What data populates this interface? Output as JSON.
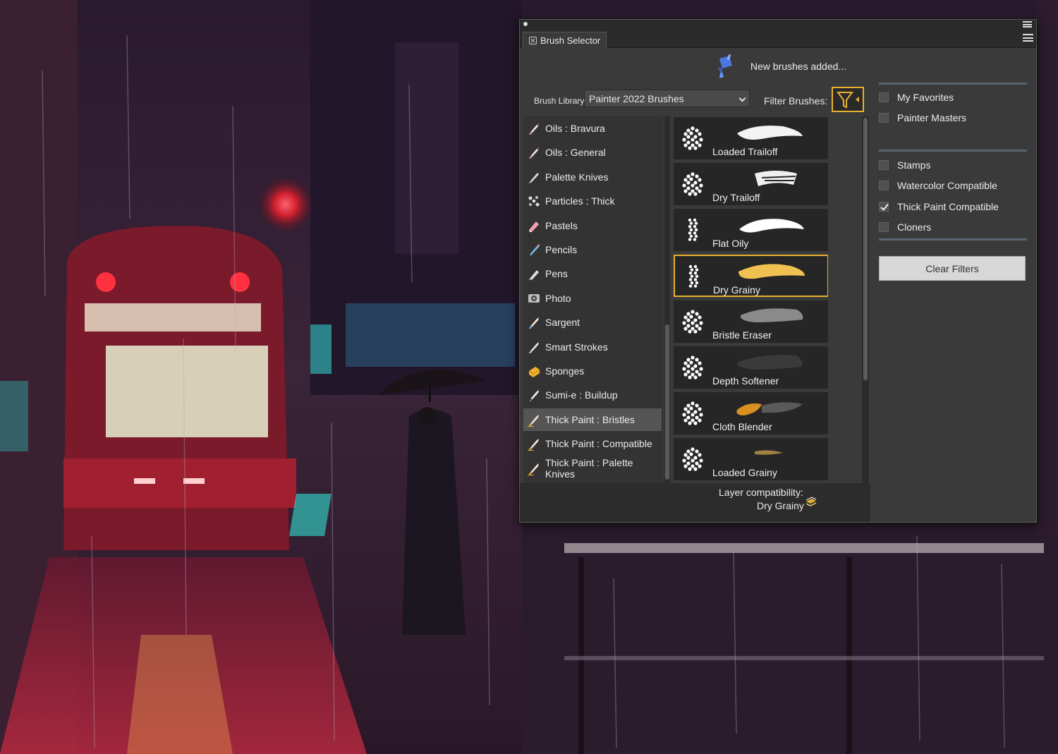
{
  "panel": {
    "tab_title": "Brush Selector",
    "notice": "New brushes added...",
    "library_label": "Brush Library:",
    "library_value": "Painter 2022 Brushes",
    "filter_label": "Filter Brushes:"
  },
  "categories": [
    {
      "label": "Oils : Bravura",
      "icon": "oil-brush-icon"
    },
    {
      "label": "Oils : General",
      "icon": "oil-brush-icon"
    },
    {
      "label": "Palette Knives",
      "icon": "palette-knife-icon"
    },
    {
      "label": "Particles : Thick",
      "icon": "particles-icon"
    },
    {
      "label": "Pastels",
      "icon": "pastel-icon"
    },
    {
      "label": "Pencils",
      "icon": "pencil-icon"
    },
    {
      "label": "Pens",
      "icon": "pen-icon"
    },
    {
      "label": "Photo",
      "icon": "photo-icon"
    },
    {
      "label": "Sargent",
      "icon": "sargent-brush-icon"
    },
    {
      "label": "Smart Strokes",
      "icon": "smart-strokes-icon"
    },
    {
      "label": "Sponges",
      "icon": "sponge-icon"
    },
    {
      "label": "Sumi-e : Buildup",
      "icon": "sumie-brush-icon"
    },
    {
      "label": "Thick Paint : Bristles",
      "icon": "thick-paint-icon"
    },
    {
      "label": "Thick Paint : Compatible",
      "icon": "thick-paint-icon"
    },
    {
      "label": "Thick Paint : Palette Knives",
      "icon": "thick-paint-icon"
    }
  ],
  "selected_category": "Thick Paint : Bristles",
  "variants": [
    {
      "label": "Loaded Trailoff"
    },
    {
      "label": "Dry Trailoff"
    },
    {
      "label": "Flat Oily"
    },
    {
      "label": "Dry Grainy"
    },
    {
      "label": "Bristle Eraser"
    },
    {
      "label": "Depth Softener"
    },
    {
      "label": "Cloth Blender"
    },
    {
      "label": "Loaded Grainy"
    }
  ],
  "selected_variant": "Dry Grainy",
  "compatibility": {
    "label": "Layer compatibility:",
    "value": "Dry Grainy"
  },
  "filters": {
    "group1": [
      {
        "label": "My Favorites",
        "checked": false
      },
      {
        "label": "Painter Masters",
        "checked": false
      }
    ],
    "group2": [
      {
        "label": "Stamps",
        "checked": false
      },
      {
        "label": "Watercolor Compatible",
        "checked": false
      },
      {
        "label": "Thick Paint Compatible",
        "checked": true
      },
      {
        "label": "Cloners",
        "checked": false
      }
    ],
    "clear_label": "Clear Filters"
  },
  "colors": {
    "accent": "#e8b030",
    "panel_bg": "#3a3a3a"
  }
}
